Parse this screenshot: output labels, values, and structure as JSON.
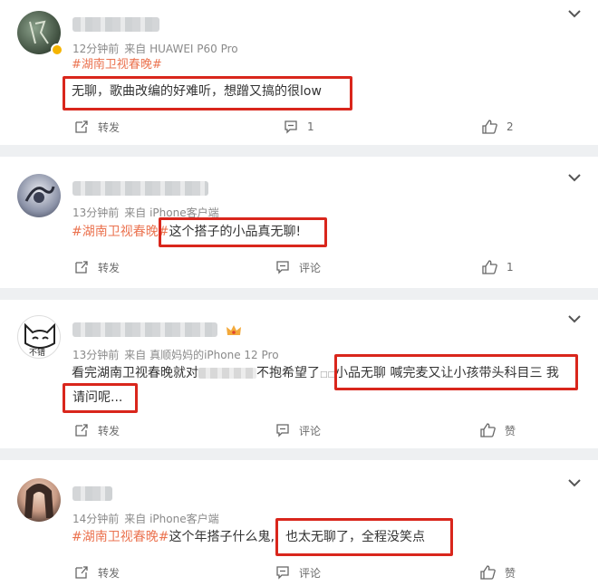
{
  "comments": [
    {
      "time": "12分钟前",
      "source": "来自 HUAWEI P60 Pro",
      "tag": "#湖南卫视春晚#",
      "text": "无聊，歌曲改编的好难听，想蹭又搞的很low",
      "actions": {
        "repost": "转发",
        "comment": "1",
        "like": "2"
      }
    },
    {
      "time": "13分钟前",
      "source": "来自 iPhone客户端",
      "tag": "#湖南卫视春晚#",
      "text": "这个搭子的小品真无聊!",
      "actions": {
        "repost": "转发",
        "comment": "评论",
        "like": "1"
      }
    },
    {
      "time": "13分钟前",
      "source": "来自 真顺妈妈的iPhone 12 Pro",
      "line1_pre": "看完湖南卫视春晚就对",
      "line1_mid": "不抱希望了",
      "line1_box": "小品无聊 喊完麦又让小孩带头科目三 我",
      "line2": "请问呢...",
      "avatar_text": "不错",
      "actions": {
        "repost": "转发",
        "comment": "评论",
        "like": "赞"
      }
    },
    {
      "time": "14分钟前",
      "source": "来自 iPhone客户端",
      "tag": "#湖南卫视春晚#",
      "text_pre": "这个年搭子什么鬼,",
      "text_box": "也太无聊了，全程没笑点",
      "actions": {
        "repost": "转发",
        "comment": "评论",
        "like": "赞"
      }
    }
  ],
  "colors": {
    "highlight": "#d9261c",
    "tag": "#eb7350",
    "vip": "#f5b400"
  },
  "icons": [
    "chevron-down-icon",
    "repost-icon",
    "comment-icon",
    "like-icon",
    "verified-badge-icon",
    "crown-icon"
  ]
}
